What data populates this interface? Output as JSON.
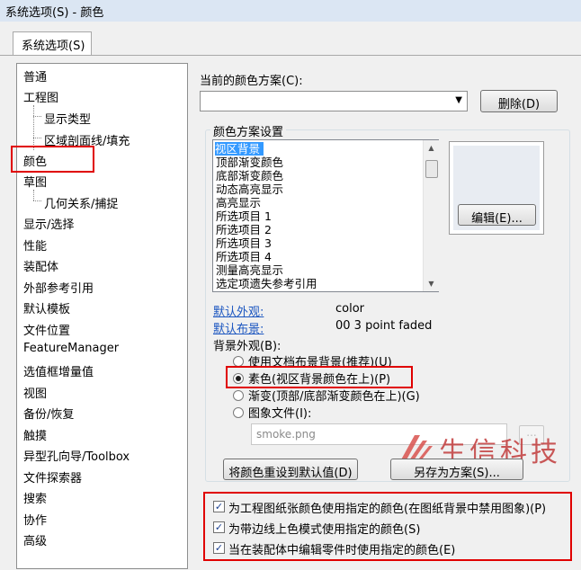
{
  "window": {
    "title": "系统选项(S) - 颜色"
  },
  "tab": {
    "label": "系统选项(S)"
  },
  "nav": {
    "items": [
      {
        "label": "普通"
      },
      {
        "label": "工程图"
      },
      {
        "label": "显示类型"
      },
      {
        "label": "区域剖面线/填充"
      },
      {
        "label": "颜色"
      },
      {
        "label": "草图"
      },
      {
        "label": "几何关系/捕捉"
      },
      {
        "label": "显示/选择"
      },
      {
        "label": "性能"
      },
      {
        "label": "装配体"
      },
      {
        "label": "外部参考引用"
      },
      {
        "label": "默认模板"
      },
      {
        "label": "文件位置"
      },
      {
        "label": "FeatureManager"
      },
      {
        "label": "选值框增量值"
      },
      {
        "label": "视图"
      },
      {
        "label": "备份/恢复"
      },
      {
        "label": "触摸"
      },
      {
        "label": "异型孔向导/Toolbox"
      },
      {
        "label": "文件探索器"
      },
      {
        "label": "搜索"
      },
      {
        "label": "协作"
      },
      {
        "label": "高级"
      }
    ]
  },
  "scheme": {
    "label": "当前的颜色方案(C):",
    "value": "",
    "delete_label": "删除(D)"
  },
  "settings": {
    "title": "颜色方案设置",
    "items": [
      {
        "label": "视区背景"
      },
      {
        "label": "顶部渐变颜色"
      },
      {
        "label": "底部渐变颜色"
      },
      {
        "label": "动态高亮显示"
      },
      {
        "label": "高亮显示"
      },
      {
        "label": "所选项目 1"
      },
      {
        "label": "所选项目 2"
      },
      {
        "label": "所选项目 3"
      },
      {
        "label": "所选项目 4"
      },
      {
        "label": "测量高亮显示"
      },
      {
        "label": "选定项遗失参考引用"
      }
    ],
    "edit_label": "编辑(E)..."
  },
  "appearance": {
    "default_label": "默认外观:",
    "default_value": "color",
    "scene_label": "默认布景:",
    "scene_value": "00 3 point faded",
    "bg_label": "背景外观(B):",
    "options": [
      {
        "label": "使用文档布景背景(推荐)(U)",
        "selected": false
      },
      {
        "label": "素色(视区背景颜色在上)(P)",
        "selected": true
      },
      {
        "label": "渐变(顶部/底部渐变颜色在上)(G)",
        "selected": false
      },
      {
        "label": "图象文件(I):",
        "selected": false
      }
    ],
    "image_file": "smoke.png",
    "browse_label": "..."
  },
  "buttons": {
    "reset_label": "将颜色重设到默认值(D)",
    "save_as_label": "另存为方案(S)..."
  },
  "checkboxes": [
    {
      "label": "为工程图纸张颜色使用指定的颜色(在图纸背景中禁用图象)(P)",
      "checked": true
    },
    {
      "label": "为带边线上色模式使用指定的颜色(S)",
      "checked": true
    },
    {
      "label": "当在装配体中编辑零件时使用指定的颜色(E)",
      "checked": true
    }
  ],
  "watermark": {
    "text": "生信科技"
  },
  "colors": {
    "highlight": "#e00000",
    "selection": "#3399ff",
    "link": "#1a55c0"
  }
}
